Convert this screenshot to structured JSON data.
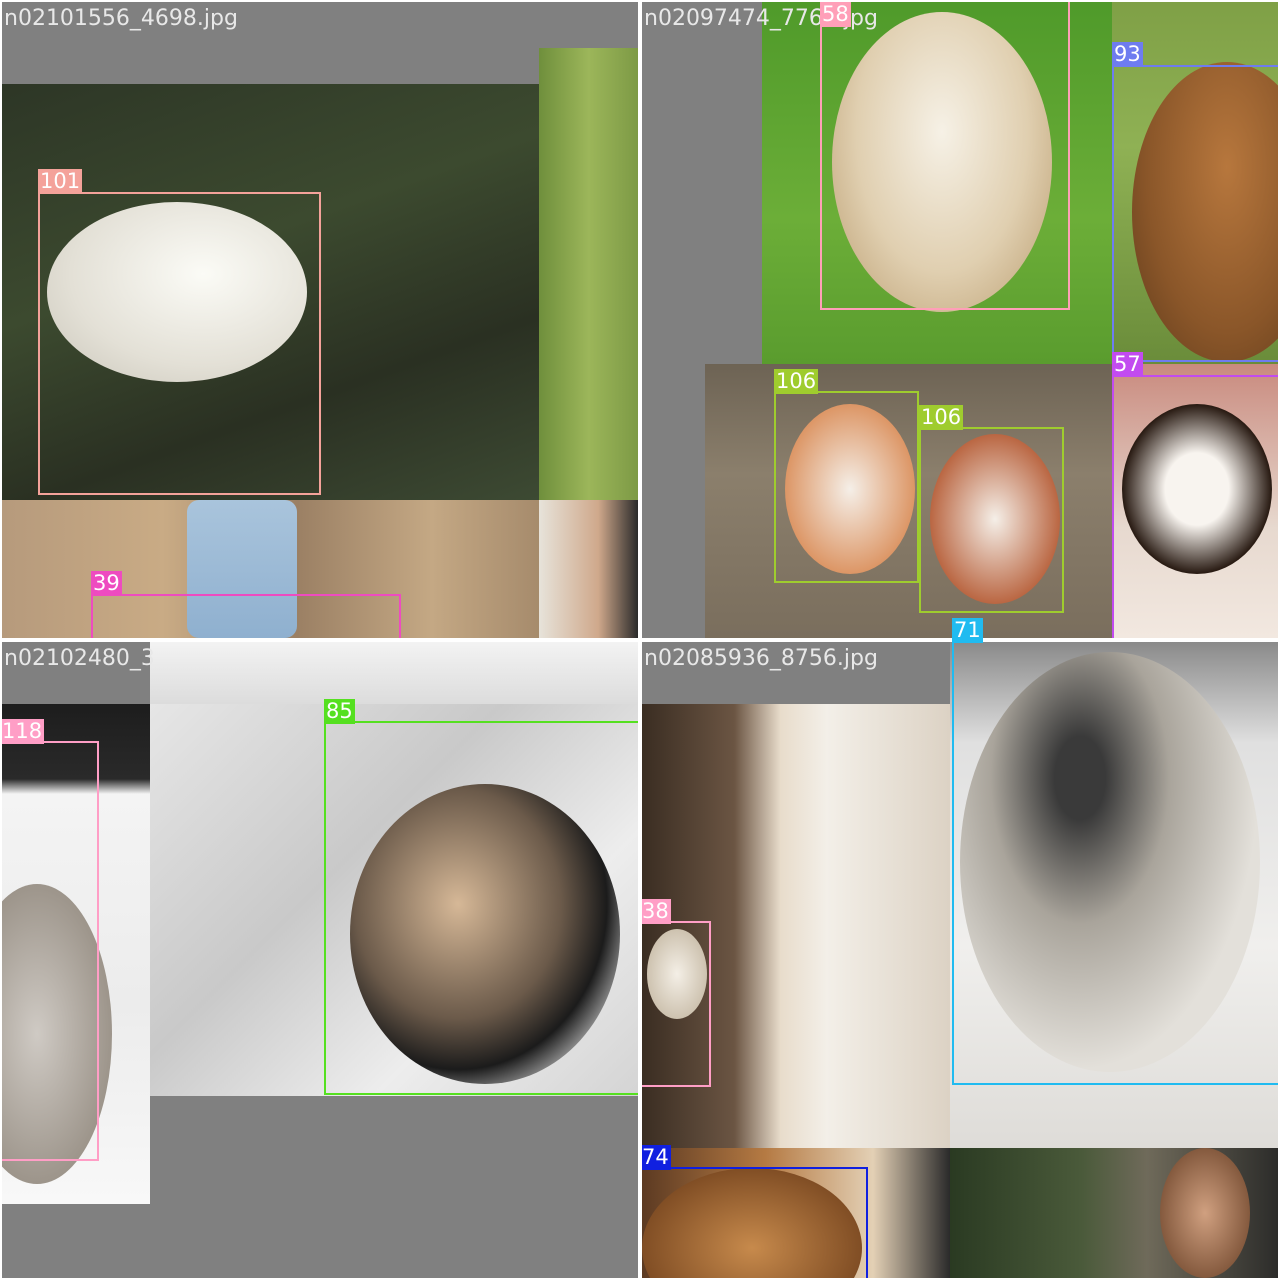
{
  "mosaic": {
    "filenames": {
      "q1": "n02101556_4698.jpg",
      "q2": "n02097474_7769.jpg",
      "q3": "n02102480_3",
      "q4": "n02085936_8756.jpg"
    },
    "boxes": [
      {
        "label": "101",
        "color": "#f4a29a"
      },
      {
        "label": "39",
        "color": "#ee4bc0"
      },
      {
        "label": "58",
        "color": "#ff9fb8"
      },
      {
        "label": "93",
        "color": "#6e7cf0"
      },
      {
        "label": "106",
        "color": "#9fcc2e"
      },
      {
        "label": "106",
        "color": "#9fcc2e"
      },
      {
        "label": "57",
        "color": "#c24bf0"
      },
      {
        "label": "118",
        "color": "#ff9ec6"
      },
      {
        "label": "85",
        "color": "#55e020"
      },
      {
        "label": "38",
        "color": "#ff9ec6"
      },
      {
        "label": "71",
        "color": "#20bbf0"
      },
      {
        "label": "74",
        "color": "#1020e0"
      }
    ]
  },
  "icons": [
    "dog-photo"
  ]
}
